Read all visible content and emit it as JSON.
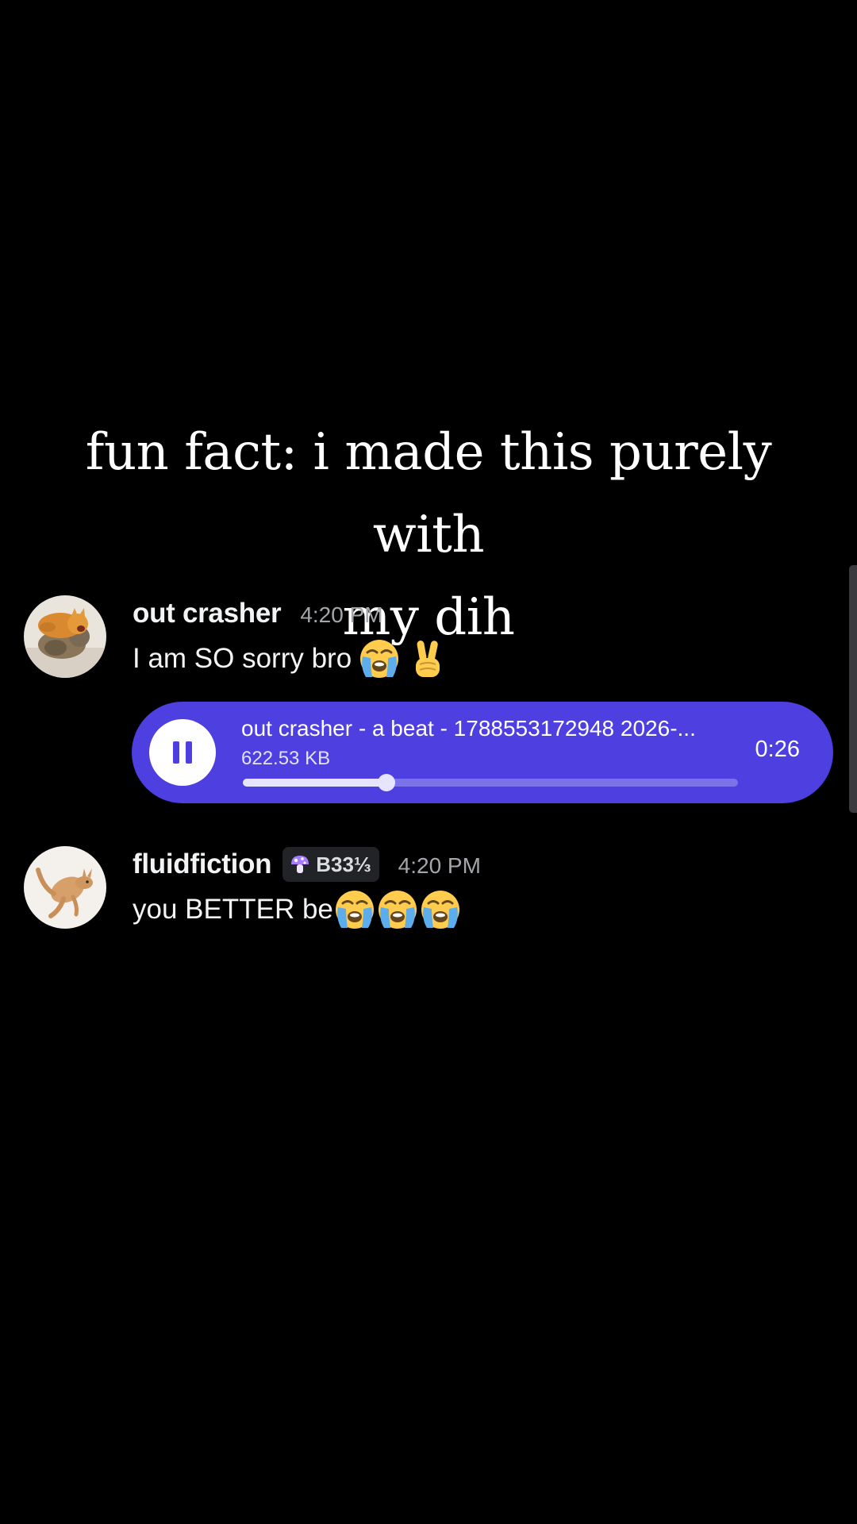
{
  "caption": {
    "line1": "fun fact: i made this purely with",
    "line2": "my dih"
  },
  "colors": {
    "background": "#000000",
    "audio_player": "#4d3fe0",
    "progress_track": "#7c72ea",
    "progress_fill": "#e6e4ff"
  },
  "messages": [
    {
      "username": "out crasher",
      "timestamp": "4:20 PM",
      "text": "I am SO sorry bro",
      "emojis": [
        "loudly-crying-face",
        "victory-hand"
      ],
      "avatar": "cats-avatar"
    },
    {
      "username": "fluidfiction",
      "role_tag": {
        "icon": "mushroom-icon",
        "label": "B33⅓"
      },
      "timestamp": "4:20 PM",
      "text": "you BETTER be",
      "emojis": [
        "loudly-crying-face",
        "loudly-crying-face",
        "loudly-crying-face"
      ],
      "avatar": "kangaroo-avatar"
    }
  ],
  "audio": {
    "file_name": "out crasher - a beat - 1788553172948 2026-...",
    "file_size": "622.53 KB",
    "duration": "0:26",
    "state_icon": "pause-icon",
    "progress": 0.29
  }
}
